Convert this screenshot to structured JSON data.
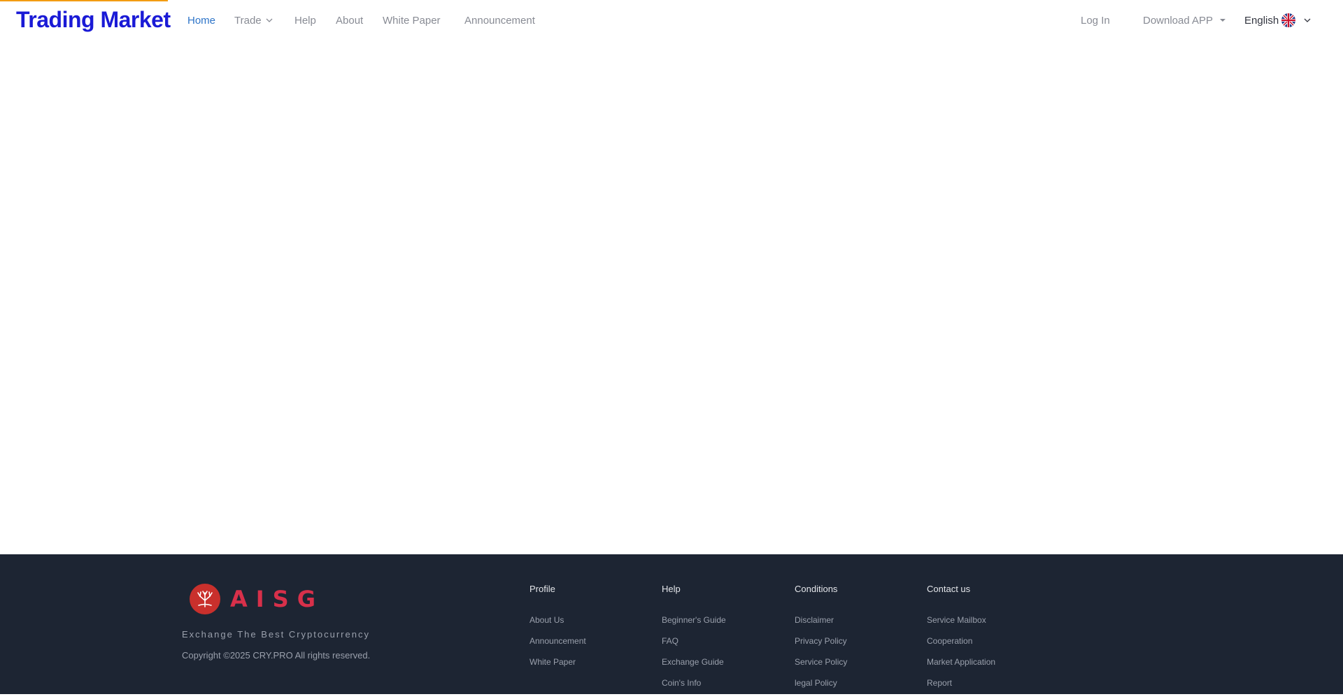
{
  "header": {
    "logo_text": "Trading Market",
    "nav": {
      "home": "Home",
      "trade": "Trade",
      "help": "Help",
      "about": "About",
      "white_paper": "White Paper",
      "announcement": "Announcement"
    },
    "right": {
      "login": "Log In",
      "download": "Download APP",
      "language": "English"
    },
    "colors": {
      "logo": "#1a1ad6",
      "active_nav": "#2d74c8",
      "accent": "#f39c12"
    }
  },
  "footer": {
    "brand": "AISG",
    "slogan": "Exchange The Best Cryptocurrency",
    "copyright": "Copyright ©2025 CRY.PRO All rights reserved.",
    "columns": [
      {
        "title": "Profile",
        "items": [
          "About Us",
          "Announcement",
          "White Paper"
        ]
      },
      {
        "title": "Help",
        "items": [
          "Beginner's Guide",
          "FAQ",
          "Exchange Guide",
          "Coin's Info"
        ]
      },
      {
        "title": "Conditions",
        "items": [
          "Disclaimer",
          "Privacy Policy",
          "Service Policy",
          "legal Policy"
        ]
      },
      {
        "title": "Contact us",
        "items": [
          "Service Mailbox",
          "Cooperation",
          "Market Application",
          "Report"
        ]
      }
    ],
    "colors": {
      "background": "#1d2533",
      "brand": "#d8304a"
    }
  },
  "icons": {
    "trade_dropdown": "chevron-down-icon",
    "download_dropdown": "caret-down-icon",
    "language_flag": "uk-flag-icon",
    "language_dropdown": "chevron-down-icon",
    "brand_emblem": "tree-emblem-icon"
  }
}
